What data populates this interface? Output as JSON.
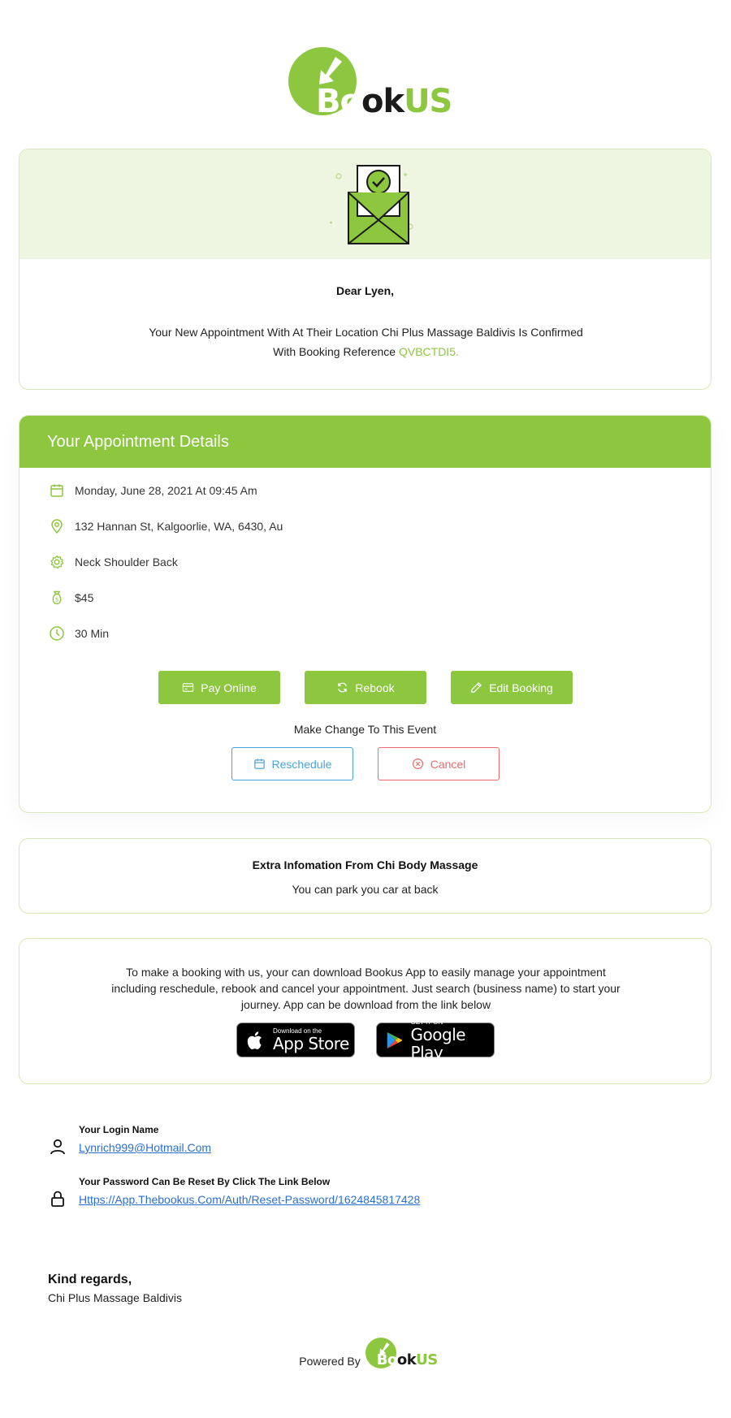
{
  "brand": {
    "logo_part1": "Bo",
    "logo_part2": "ok",
    "logo_part3": "US",
    "accent_color": "#8dc63f"
  },
  "hero": {
    "greeting": "Dear Lyen,",
    "intro_text": "Your New Appointment With At Their Location Chi Plus Massage Baldivis Is Confirmed With Booking Reference",
    "booking_reference": "QVBCTDI5."
  },
  "appointment": {
    "header": "Your Appointment Details",
    "date_time": "Monday, June 28, 2021 At 09:45 Am",
    "address": "132 Hannan St, Kalgoorlie, WA, 6430, Au",
    "service": "Neck Shoulder Back",
    "price": "$45",
    "duration": "30 Min",
    "pay_online_label": "Pay Online",
    "rebook_label": "Rebook",
    "edit_booking_label": "Edit Booking",
    "change_text": "Make Change To This Event",
    "reschedule_label": "Reschedule",
    "cancel_label": "Cancel"
  },
  "extra": {
    "title": "Extra Infomation From Chi Body Massage",
    "text": "You can park you car at back"
  },
  "app_info": {
    "text": "To make a booking with us, your can download Bookus App to easily manage your appointment including reschedule, rebook and cancel your appointment. Just search (business name) to start your journey. App can be download from the link below",
    "app_store_small": "Download on the",
    "app_store_big": "App Store",
    "google_play_small": "GET IT ON",
    "google_play_big": "Google Play"
  },
  "account": {
    "login_label": "Your Login Name",
    "login_value": "Lynrich999@Hotmail.Com",
    "password_label": "Your Password Can Be Reset By Click The Link Below",
    "password_link": "Https://App.Thebookus.Com/Auth/Reset-Password/1624845817428"
  },
  "footer": {
    "regards": "Kind regards,",
    "business_name": "Chi Plus Massage Baldivis",
    "powered_by": "Powered By"
  }
}
